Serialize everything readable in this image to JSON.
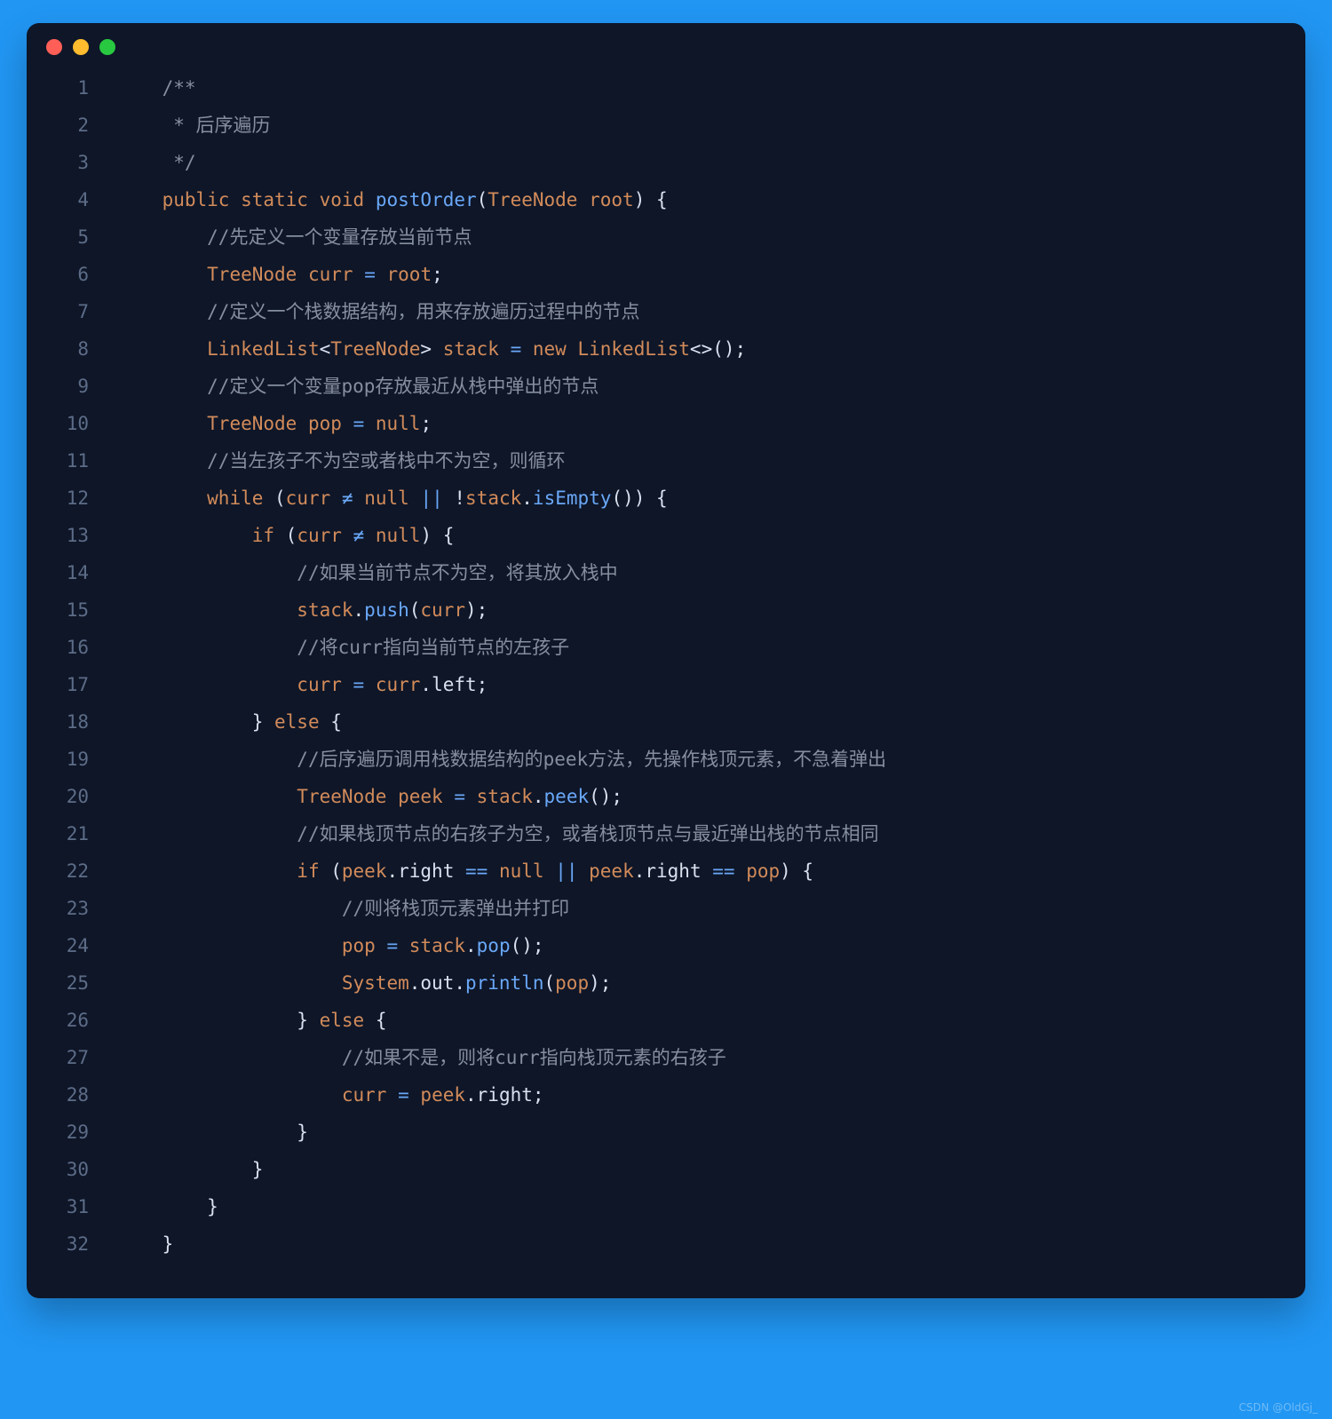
{
  "watermark": "CSDN @OldGj_",
  "traffic_lights": {
    "close": "#ff5f57",
    "min": "#febc2e",
    "max": "#28c840"
  },
  "lines": [
    {
      "n": 1,
      "indent": "    ",
      "tokens": [
        {
          "c": "c-comment",
          "t": "/**"
        }
      ]
    },
    {
      "n": 2,
      "indent": "     ",
      "tokens": [
        {
          "c": "c-comment",
          "t": "* 后序遍历"
        }
      ]
    },
    {
      "n": 3,
      "indent": "     ",
      "tokens": [
        {
          "c": "c-comment",
          "t": "*/"
        }
      ]
    },
    {
      "n": 4,
      "indent": "    ",
      "tokens": [
        {
          "c": "c-kw",
          "t": "public"
        },
        {
          "c": "c-pun",
          "t": " "
        },
        {
          "c": "c-kw",
          "t": "static"
        },
        {
          "c": "c-pun",
          "t": " "
        },
        {
          "c": "c-kw",
          "t": "void"
        },
        {
          "c": "c-pun",
          "t": " "
        },
        {
          "c": "c-fn",
          "t": "postOrder"
        },
        {
          "c": "c-paren",
          "t": "("
        },
        {
          "c": "c-type",
          "t": "TreeNode"
        },
        {
          "c": "c-pun",
          "t": " "
        },
        {
          "c": "c-var",
          "t": "root"
        },
        {
          "c": "c-paren",
          "t": ")"
        },
        {
          "c": "c-pun",
          "t": " {"
        }
      ]
    },
    {
      "n": 5,
      "indent": "        ",
      "tokens": [
        {
          "c": "c-comment",
          "t": "//先定义一个变量存放当前节点"
        }
      ]
    },
    {
      "n": 6,
      "indent": "        ",
      "tokens": [
        {
          "c": "c-type",
          "t": "TreeNode"
        },
        {
          "c": "c-pun",
          "t": " "
        },
        {
          "c": "c-var",
          "t": "curr"
        },
        {
          "c": "c-pun",
          "t": " "
        },
        {
          "c": "c-op",
          "t": "="
        },
        {
          "c": "c-pun",
          "t": " "
        },
        {
          "c": "c-var",
          "t": "root"
        },
        {
          "c": "c-pun",
          "t": ";"
        }
      ]
    },
    {
      "n": 7,
      "indent": "        ",
      "tokens": [
        {
          "c": "c-comment",
          "t": "//定义一个栈数据结构，用来存放遍历过程中的节点"
        }
      ]
    },
    {
      "n": 8,
      "indent": "        ",
      "tokens": [
        {
          "c": "c-type",
          "t": "LinkedList"
        },
        {
          "c": "c-pun",
          "t": "<"
        },
        {
          "c": "c-type",
          "t": "TreeNode"
        },
        {
          "c": "c-pun",
          "t": "> "
        },
        {
          "c": "c-var",
          "t": "stack"
        },
        {
          "c": "c-pun",
          "t": " "
        },
        {
          "c": "c-op",
          "t": "="
        },
        {
          "c": "c-pun",
          "t": " "
        },
        {
          "c": "c-kw",
          "t": "new"
        },
        {
          "c": "c-pun",
          "t": " "
        },
        {
          "c": "c-type",
          "t": "LinkedList"
        },
        {
          "c": "c-pun",
          "t": "<>();"
        }
      ]
    },
    {
      "n": 9,
      "indent": "        ",
      "tokens": [
        {
          "c": "c-comment",
          "t": "//定义一个变量pop存放最近从栈中弹出的节点"
        }
      ]
    },
    {
      "n": 10,
      "indent": "        ",
      "tokens": [
        {
          "c": "c-type",
          "t": "TreeNode"
        },
        {
          "c": "c-pun",
          "t": " "
        },
        {
          "c": "c-var",
          "t": "pop"
        },
        {
          "c": "c-pun",
          "t": " "
        },
        {
          "c": "c-op",
          "t": "="
        },
        {
          "c": "c-pun",
          "t": " "
        },
        {
          "c": "c-null",
          "t": "null"
        },
        {
          "c": "c-pun",
          "t": ";"
        }
      ]
    },
    {
      "n": 11,
      "indent": "        ",
      "tokens": [
        {
          "c": "c-comment",
          "t": "//当左孩子不为空或者栈中不为空，则循环"
        }
      ]
    },
    {
      "n": 12,
      "indent": "        ",
      "tokens": [
        {
          "c": "c-kw",
          "t": "while"
        },
        {
          "c": "c-pun",
          "t": " ("
        },
        {
          "c": "c-var",
          "t": "curr"
        },
        {
          "c": "c-pun",
          "t": " "
        },
        {
          "c": "c-op",
          "t": "≠"
        },
        {
          "c": "c-pun",
          "t": " "
        },
        {
          "c": "c-null",
          "t": "null"
        },
        {
          "c": "c-pun",
          "t": " "
        },
        {
          "c": "c-op",
          "t": "||"
        },
        {
          "c": "c-pun",
          "t": " !"
        },
        {
          "c": "c-var",
          "t": "stack"
        },
        {
          "c": "c-pun",
          "t": "."
        },
        {
          "c": "c-fn",
          "t": "isEmpty"
        },
        {
          "c": "c-pun",
          "t": "()) {"
        }
      ]
    },
    {
      "n": 13,
      "indent": "            ",
      "tokens": [
        {
          "c": "c-kw",
          "t": "if"
        },
        {
          "c": "c-pun",
          "t": " ("
        },
        {
          "c": "c-var",
          "t": "curr"
        },
        {
          "c": "c-pun",
          "t": " "
        },
        {
          "c": "c-op",
          "t": "≠"
        },
        {
          "c": "c-pun",
          "t": " "
        },
        {
          "c": "c-null",
          "t": "null"
        },
        {
          "c": "c-pun",
          "t": ") {"
        }
      ]
    },
    {
      "n": 14,
      "indent": "                ",
      "tokens": [
        {
          "c": "c-comment",
          "t": "//如果当前节点不为空，将其放入栈中"
        }
      ]
    },
    {
      "n": 15,
      "indent": "                ",
      "tokens": [
        {
          "c": "c-var",
          "t": "stack"
        },
        {
          "c": "c-pun",
          "t": "."
        },
        {
          "c": "c-fn",
          "t": "push"
        },
        {
          "c": "c-pun",
          "t": "("
        },
        {
          "c": "c-var",
          "t": "curr"
        },
        {
          "c": "c-pun",
          "t": ");"
        }
      ]
    },
    {
      "n": 16,
      "indent": "                ",
      "tokens": [
        {
          "c": "c-comment",
          "t": "//将curr指向当前节点的左孩子"
        }
      ]
    },
    {
      "n": 17,
      "indent": "                ",
      "tokens": [
        {
          "c": "c-var",
          "t": "curr"
        },
        {
          "c": "c-pun",
          "t": " "
        },
        {
          "c": "c-op",
          "t": "="
        },
        {
          "c": "c-pun",
          "t": " "
        },
        {
          "c": "c-var",
          "t": "curr"
        },
        {
          "c": "c-pun",
          "t": "."
        },
        {
          "c": "c-prop",
          "t": "left"
        },
        {
          "c": "c-pun",
          "t": ";"
        }
      ]
    },
    {
      "n": 18,
      "indent": "            ",
      "tokens": [
        {
          "c": "c-pun",
          "t": "} "
        },
        {
          "c": "c-kw",
          "t": "else"
        },
        {
          "c": "c-pun",
          "t": " {"
        }
      ]
    },
    {
      "n": 19,
      "indent": "                ",
      "tokens": [
        {
          "c": "c-comment",
          "t": "//后序遍历调用栈数据结构的peek方法，先操作栈顶元素，不急着弹出"
        }
      ]
    },
    {
      "n": 20,
      "indent": "                ",
      "tokens": [
        {
          "c": "c-type",
          "t": "TreeNode"
        },
        {
          "c": "c-pun",
          "t": " "
        },
        {
          "c": "c-var",
          "t": "peek"
        },
        {
          "c": "c-pun",
          "t": " "
        },
        {
          "c": "c-op",
          "t": "="
        },
        {
          "c": "c-pun",
          "t": " "
        },
        {
          "c": "c-var",
          "t": "stack"
        },
        {
          "c": "c-pun",
          "t": "."
        },
        {
          "c": "c-fn",
          "t": "peek"
        },
        {
          "c": "c-pun",
          "t": "();"
        }
      ]
    },
    {
      "n": 21,
      "indent": "                ",
      "tokens": [
        {
          "c": "c-comment",
          "t": "//如果栈顶节点的右孩子为空，或者栈顶节点与最近弹出栈的节点相同"
        }
      ]
    },
    {
      "n": 22,
      "indent": "                ",
      "tokens": [
        {
          "c": "c-kw",
          "t": "if"
        },
        {
          "c": "c-pun",
          "t": " ("
        },
        {
          "c": "c-var",
          "t": "peek"
        },
        {
          "c": "c-pun",
          "t": "."
        },
        {
          "c": "c-prop",
          "t": "right"
        },
        {
          "c": "c-pun",
          "t": " "
        },
        {
          "c": "c-op",
          "t": "=="
        },
        {
          "c": "c-pun",
          "t": " "
        },
        {
          "c": "c-null",
          "t": "null"
        },
        {
          "c": "c-pun",
          "t": " "
        },
        {
          "c": "c-op",
          "t": "||"
        },
        {
          "c": "c-pun",
          "t": " "
        },
        {
          "c": "c-var",
          "t": "peek"
        },
        {
          "c": "c-pun",
          "t": "."
        },
        {
          "c": "c-prop",
          "t": "right"
        },
        {
          "c": "c-pun",
          "t": " "
        },
        {
          "c": "c-op",
          "t": "=="
        },
        {
          "c": "c-pun",
          "t": " "
        },
        {
          "c": "c-var",
          "t": "pop"
        },
        {
          "c": "c-pun",
          "t": ") {"
        }
      ]
    },
    {
      "n": 23,
      "indent": "                    ",
      "tokens": [
        {
          "c": "c-comment",
          "t": "//则将栈顶元素弹出并打印"
        }
      ]
    },
    {
      "n": 24,
      "indent": "                    ",
      "tokens": [
        {
          "c": "c-var",
          "t": "pop"
        },
        {
          "c": "c-pun",
          "t": " "
        },
        {
          "c": "c-op",
          "t": "="
        },
        {
          "c": "c-pun",
          "t": " "
        },
        {
          "c": "c-var",
          "t": "stack"
        },
        {
          "c": "c-pun",
          "t": "."
        },
        {
          "c": "c-fn",
          "t": "pop"
        },
        {
          "c": "c-pun",
          "t": "();"
        }
      ]
    },
    {
      "n": 25,
      "indent": "                    ",
      "tokens": [
        {
          "c": "c-type",
          "t": "System"
        },
        {
          "c": "c-pun",
          "t": "."
        },
        {
          "c": "c-prop",
          "t": "out"
        },
        {
          "c": "c-pun",
          "t": "."
        },
        {
          "c": "c-fn",
          "t": "println"
        },
        {
          "c": "c-pun",
          "t": "("
        },
        {
          "c": "c-var",
          "t": "pop"
        },
        {
          "c": "c-pun",
          "t": ");"
        }
      ]
    },
    {
      "n": 26,
      "indent": "                ",
      "tokens": [
        {
          "c": "c-pun",
          "t": "} "
        },
        {
          "c": "c-kw",
          "t": "else"
        },
        {
          "c": "c-pun",
          "t": " {"
        }
      ]
    },
    {
      "n": 27,
      "indent": "                    ",
      "tokens": [
        {
          "c": "c-comment",
          "t": "//如果不是，则将curr指向栈顶元素的右孩子"
        }
      ]
    },
    {
      "n": 28,
      "indent": "                    ",
      "tokens": [
        {
          "c": "c-var",
          "t": "curr"
        },
        {
          "c": "c-pun",
          "t": " "
        },
        {
          "c": "c-op",
          "t": "="
        },
        {
          "c": "c-pun",
          "t": " "
        },
        {
          "c": "c-var",
          "t": "peek"
        },
        {
          "c": "c-pun",
          "t": "."
        },
        {
          "c": "c-prop",
          "t": "right"
        },
        {
          "c": "c-pun",
          "t": ";"
        }
      ]
    },
    {
      "n": 29,
      "indent": "                ",
      "tokens": [
        {
          "c": "c-pun",
          "t": "}"
        }
      ]
    },
    {
      "n": 30,
      "indent": "            ",
      "tokens": [
        {
          "c": "c-pun",
          "t": "}"
        }
      ]
    },
    {
      "n": 31,
      "indent": "        ",
      "tokens": [
        {
          "c": "c-pun",
          "t": "}"
        }
      ]
    },
    {
      "n": 32,
      "indent": "    ",
      "tokens": [
        {
          "c": "c-pun",
          "t": "}"
        }
      ]
    }
  ]
}
